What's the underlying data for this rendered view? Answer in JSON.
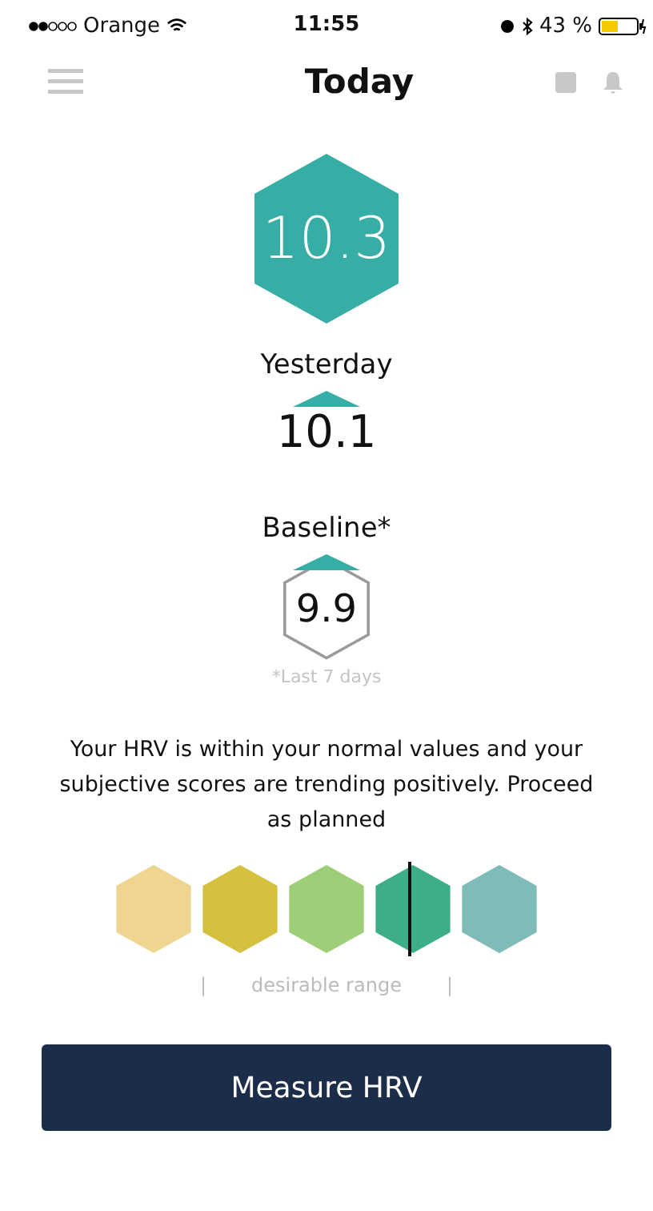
{
  "status_bar": {
    "carrier": "Orange",
    "time": "11:55",
    "battery": "43 %"
  },
  "header": {
    "title": "Today"
  },
  "today": {
    "value": "10.3"
  },
  "yesterday": {
    "label": "Yesterday",
    "rising": true,
    "value": "10.1"
  },
  "baseline": {
    "label": "Baseline*",
    "rising": true,
    "value": "9.9",
    "note": "*Last 7 days"
  },
  "message": "Your HRV is within your normal values and your subjective scores are trending positively. Proceed as planned",
  "scale": [
    {
      "color": "#efd58f",
      "selected": false
    },
    {
      "color": "#d6c040",
      "selected": false
    },
    {
      "color": "#9fce78",
      "selected": false
    },
    {
      "color": "#3daf86",
      "selected": true
    },
    {
      "color": "#7fbcb8",
      "selected": false
    }
  ],
  "range": {
    "left": "|",
    "label": "desirable range",
    "right": "|"
  },
  "button": "Measure HRV"
}
